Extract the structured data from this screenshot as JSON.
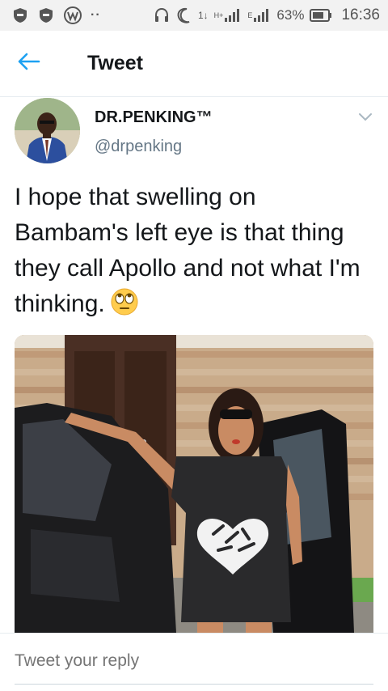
{
  "status_bar": {
    "battery_percent": "63%",
    "time": "16:36",
    "network_label": "H+",
    "sim2_label": "E",
    "data_arrows": "1↓",
    "icons": [
      "shield-icon",
      "shield-icon",
      "wordpress-icon",
      "more-dots-icon",
      "headset-icon",
      "moon-icon",
      "data-transfer-icon",
      "signal-icon",
      "signal-icon",
      "battery-icon"
    ]
  },
  "header": {
    "back_icon": "back-arrow-icon",
    "title": "Tweet"
  },
  "tweet": {
    "display_name": "DR.PENKING™",
    "handle": "@drpenking",
    "text": "I hope that swelling on Bambam's left eye is that thing they call Apollo and not what I'm thinking.",
    "emoji": "face-with-rolling-eyes"
  },
  "reply": {
    "placeholder": "Tweet your reply"
  },
  "colors": {
    "accent": "#1da1f2",
    "text": "#14171a",
    "muted": "#657786",
    "divider": "#e6ecf0"
  }
}
